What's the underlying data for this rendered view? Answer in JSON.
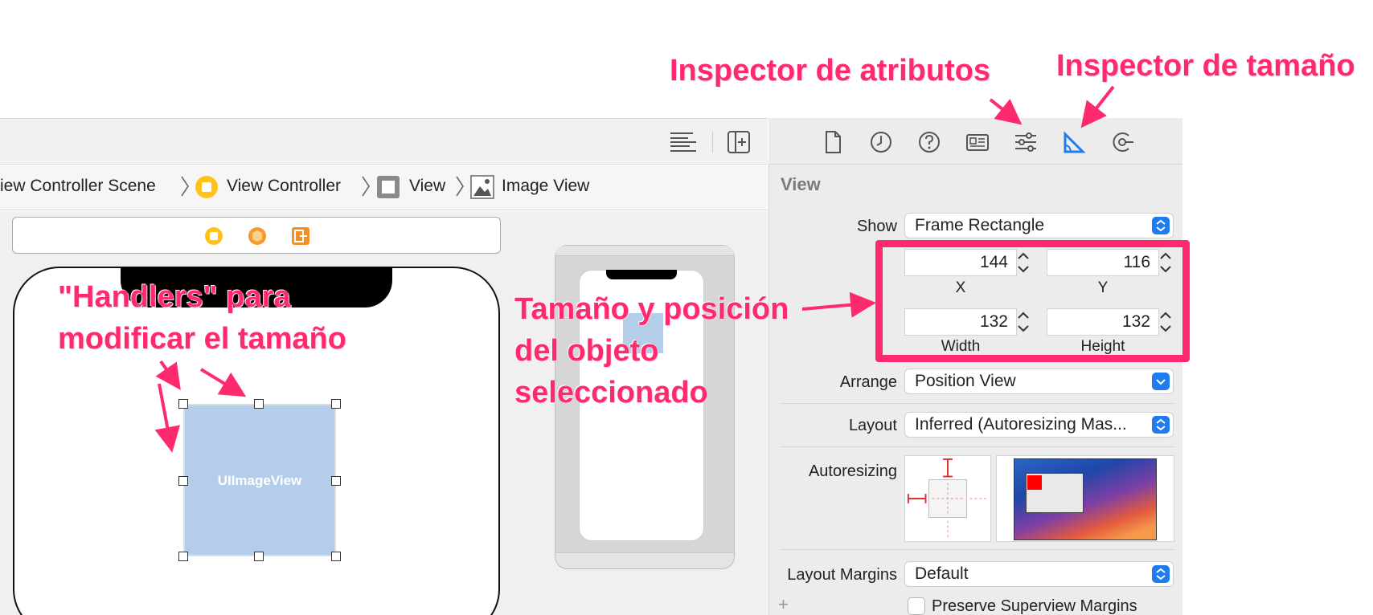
{
  "annotations": {
    "attr_inspector": "Inspector de atributos",
    "size_inspector": "Inspector de tamaño",
    "handlers_line1": "\"Handlers\" para",
    "handlers_line2": "modificar el tamaño",
    "size_pos_line1": "Tamaño y posición",
    "size_pos_line2": "del objeto",
    "size_pos_line3": "seleccionado"
  },
  "jumpbar": {
    "items": [
      {
        "label": "iew Controller Scene",
        "icon": "scene-icon"
      },
      {
        "label": "View Controller",
        "icon": "view-controller-icon"
      },
      {
        "label": "View",
        "icon": "view-icon"
      },
      {
        "label": "Image View",
        "icon": "image-view-icon"
      }
    ]
  },
  "canvas": {
    "image_view_label": "UIImageView"
  },
  "inspector": {
    "tabs": [
      "file-inspector-icon",
      "history-inspector-icon",
      "help-inspector-icon",
      "identity-inspector-icon",
      "attributes-inspector-icon",
      "size-inspector-icon",
      "connections-inspector-icon"
    ],
    "active_tab": "size-inspector-icon",
    "section_title": "View",
    "show_label": "Show",
    "show_value": "Frame Rectangle",
    "x_value": "144",
    "y_value": "116",
    "width_value": "132",
    "height_value": "132",
    "x_caption": "X",
    "y_caption": "Y",
    "width_caption": "Width",
    "height_caption": "Height",
    "arrange_label": "Arrange",
    "arrange_value": "Position View",
    "layout_label": "Layout",
    "layout_value": "Inferred (Autoresizing Mas...",
    "autoresizing_label": "Autoresizing",
    "layout_margins_label": "Layout Margins",
    "layout_margins_value": "Default",
    "add_symbol": "+",
    "preserve_label": "Preserve Superview Margins"
  },
  "colors": {
    "annotation": "#ff2a6d",
    "accent": "#1f7cf0",
    "image_view_fill": "#b4cde9"
  }
}
